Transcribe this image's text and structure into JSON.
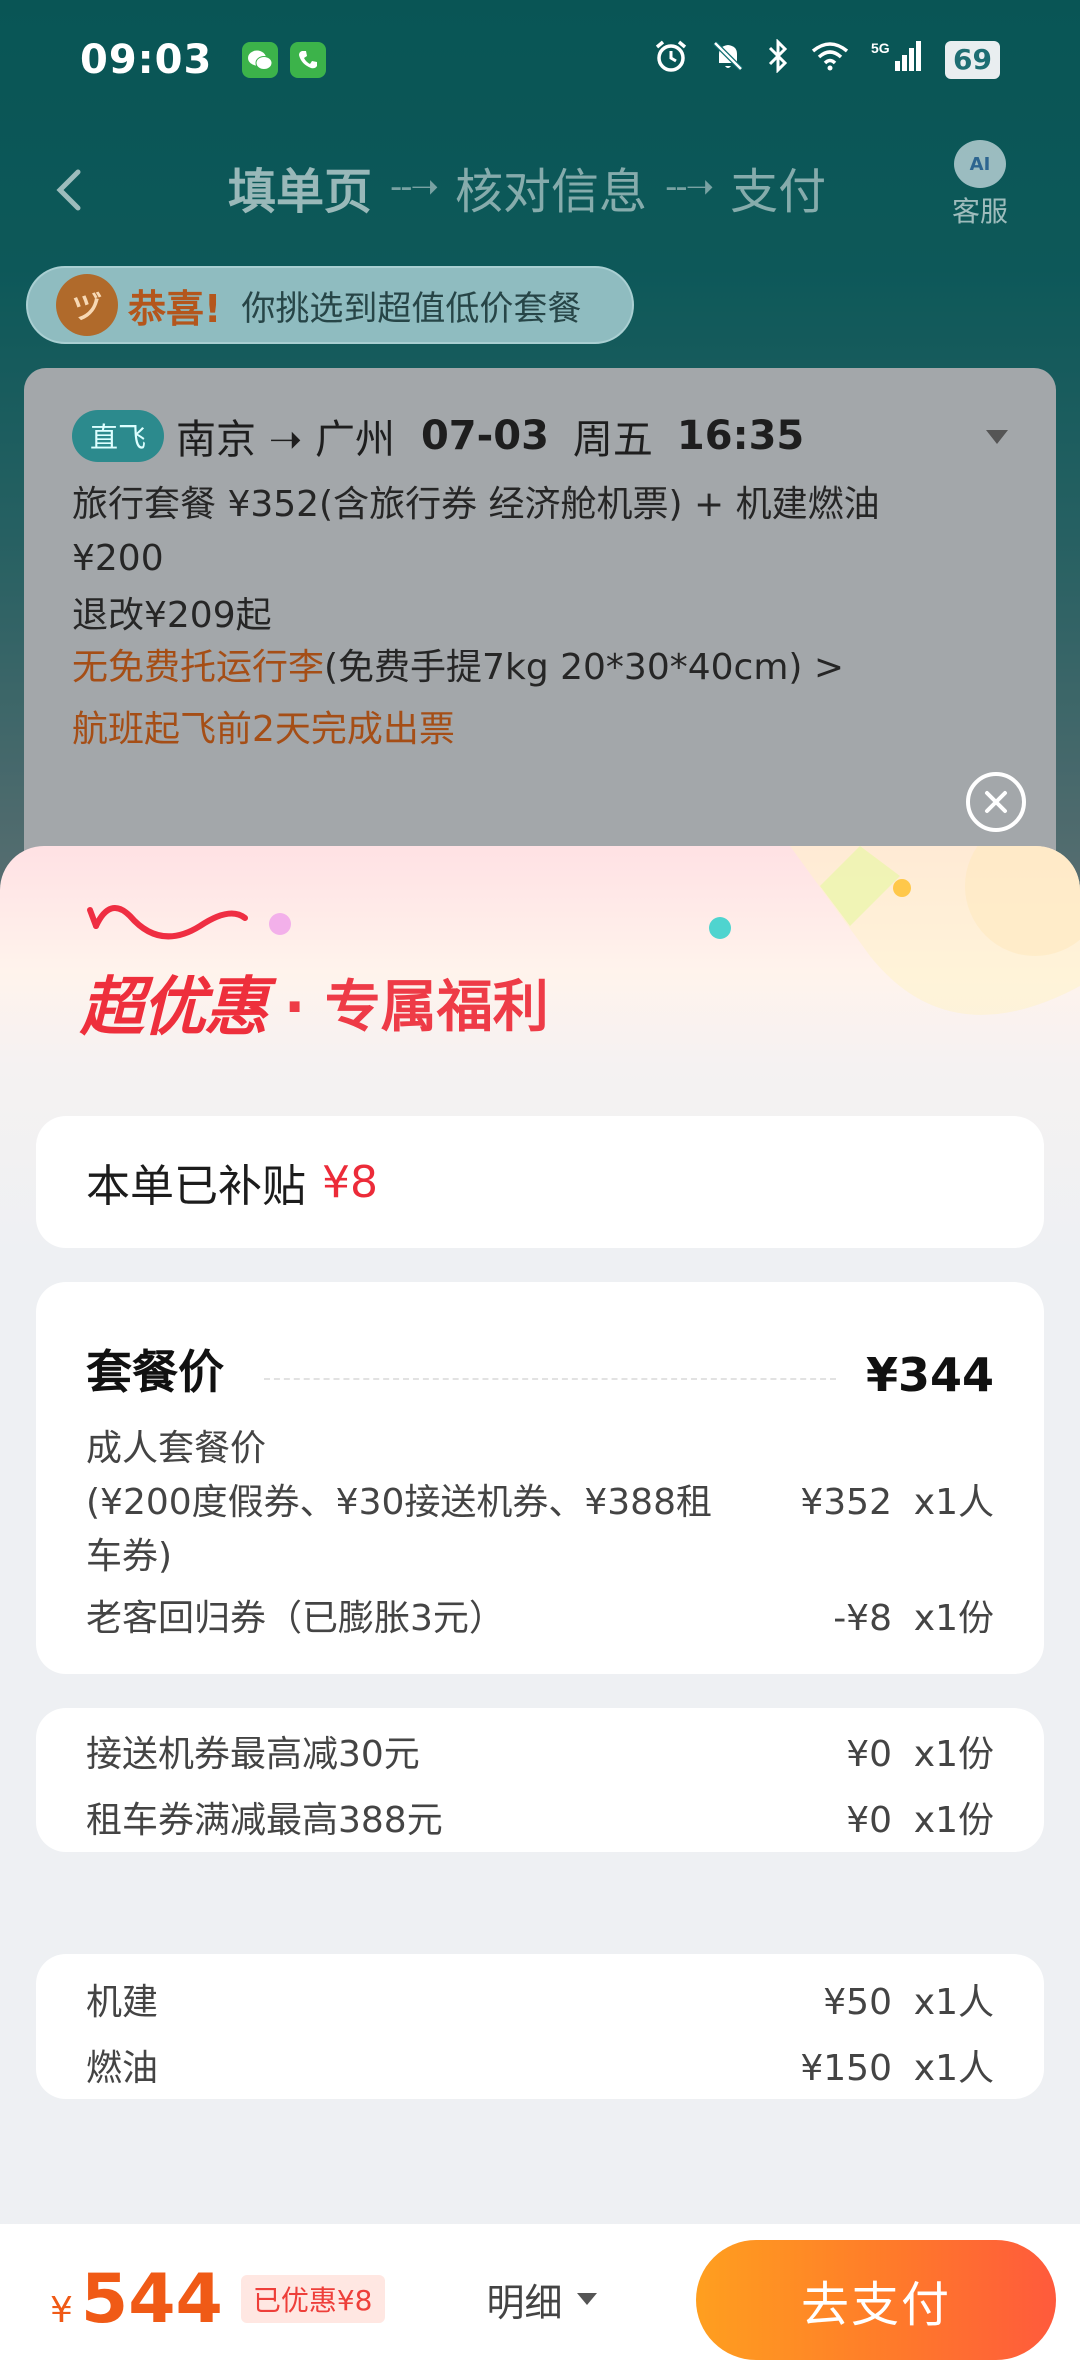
{
  "status_bar": {
    "time": "09:03",
    "battery": "69",
    "network": "5G"
  },
  "nav": {
    "steps": [
      "填单页",
      "核对信息",
      "支付"
    ],
    "step_arrow": "--➝",
    "service_icon_text": "AI",
    "service_label": "客服"
  },
  "congrats": {
    "icon_text": "ヅ",
    "strong": "恭喜!",
    "text": "你挑选到超值低价套餐"
  },
  "flight": {
    "tag": "直飞",
    "route": "南京 ➝ 广州",
    "date": "07-03",
    "weekday": "周五",
    "time": "16:35",
    "package": "旅行套餐 ¥352(含旅行券 经济舱机票) + 机建燃油 ¥200",
    "refund": "退改¥209起",
    "baggage_warning": "无免费托运行李",
    "baggage_detail": "(免费手提7kg 20*30*40cm) >",
    "ticketing": "航班起飞前2天完成出票"
  },
  "sheet": {
    "title_strong": "超优惠",
    "title_sub": "· 专属福利",
    "subsidy_label": "本单已补贴",
    "subsidy_amount": "¥8",
    "price": {
      "label": "套餐价",
      "value": "¥344",
      "adult_title": "成人套餐价",
      "adult_desc": "(¥200度假券、¥30接送机券、¥388租车券)",
      "adult_amount": "¥352",
      "adult_qty": "x1人",
      "coupon_label": "老客回归券（已膨胀3元）",
      "coupon_amount": "-¥8",
      "coupon_qty": "x1份"
    },
    "coupons": [
      {
        "label": "接送机券最高减30元",
        "amount": "¥0",
        "qty": "x1份"
      },
      {
        "label": "租车券满减最高388元",
        "amount": "¥0",
        "qty": "x1份"
      }
    ],
    "taxes": [
      {
        "label": "机建",
        "amount": "¥50",
        "qty": "x1人"
      },
      {
        "label": "燃油",
        "amount": "¥150",
        "qty": "x1人"
      }
    ]
  },
  "bottom": {
    "currency": "¥",
    "total": "544",
    "saved": "已优惠¥8",
    "detail": "明细",
    "pay": "去支付"
  },
  "colors": {
    "accent_red": "#ec2b39",
    "orange": "#f05a16",
    "teal": "#0f8a8a"
  }
}
